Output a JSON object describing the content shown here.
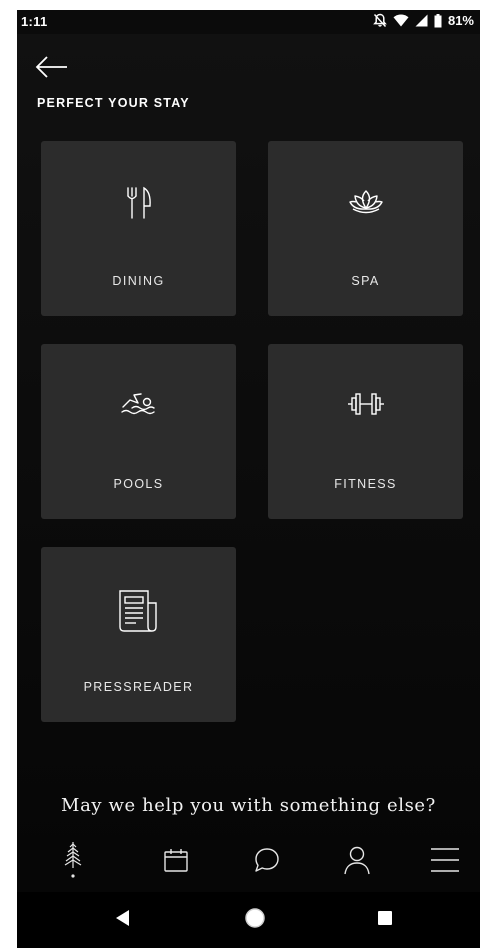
{
  "status_bar": {
    "time": "1:11",
    "battery": "81%",
    "icons": [
      "notifications-off-icon",
      "wifi-icon",
      "signal-icon",
      "battery-icon"
    ]
  },
  "header": {
    "back_icon": "arrow-left-icon",
    "title": "PERFECT YOUR STAY"
  },
  "tiles": [
    {
      "label": "DINING",
      "icon": "fork-knife-icon"
    },
    {
      "label": "SPA",
      "icon": "lotus-icon"
    },
    {
      "label": "POOLS",
      "icon": "swimmer-icon"
    },
    {
      "label": "FITNESS",
      "icon": "dumbbell-icon"
    },
    {
      "label": "PRESSREADER",
      "icon": "newspaper-icon"
    }
  ],
  "help": {
    "text": "May we help you with something else?"
  },
  "app_nav": {
    "items": [
      "tree-logo-icon",
      "calendar-icon",
      "chat-bubble-icon",
      "profile-icon",
      "menu-icon"
    ]
  },
  "android_nav": {
    "items": [
      "back-triangle-icon",
      "home-circle-icon",
      "recents-square-icon"
    ]
  },
  "colors": {
    "background": "#0b0b0b",
    "tile": "#2c2c2c",
    "text": "#ffffff"
  }
}
